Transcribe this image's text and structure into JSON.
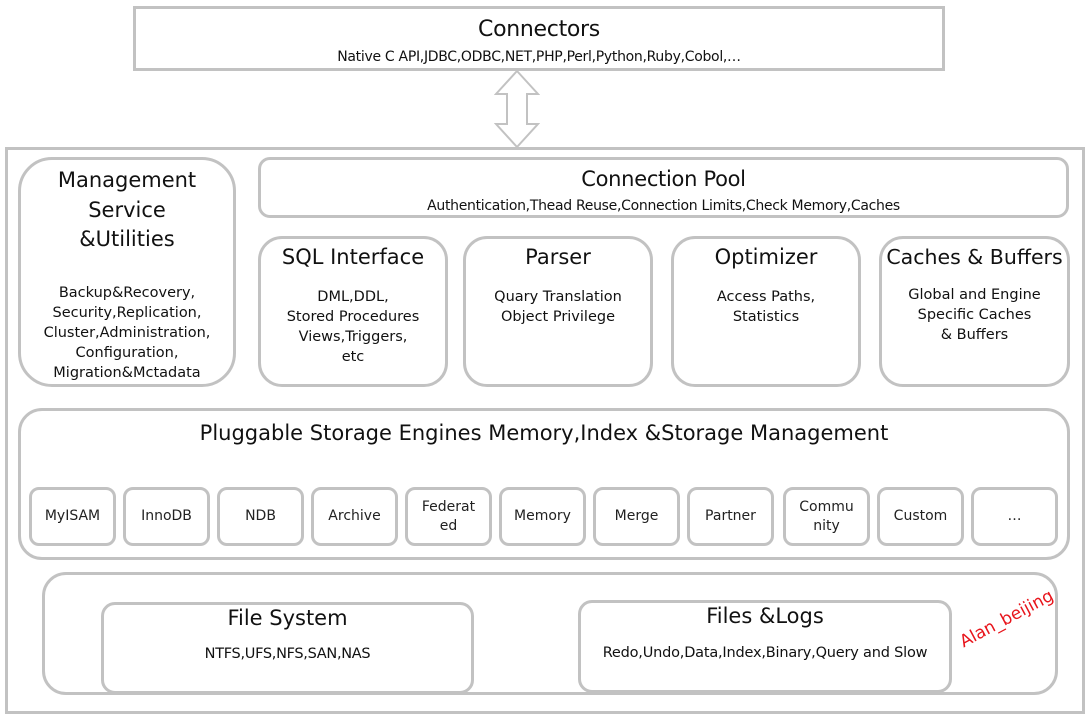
{
  "connectors": {
    "title": "Connectors",
    "items": "Native C API,JDBC,ODBC,NET,PHP,Perl,Python,Ruby,Cobol,…"
  },
  "arrow": {
    "icon": "double-headed-vertical-arrow"
  },
  "management": {
    "title": "Management\nService\n&Utilities",
    "items": "Backup&Recovery,\nSecurity,Replication,\nCluster,Administration,\nConfiguration,\nMigration&Mctadata"
  },
  "connection_pool": {
    "title": "Connection Pool",
    "items": "Authentication,Thead Reuse,Connection Limits,Check Memory,Caches"
  },
  "sql_interface": {
    "title": "SQL Interface",
    "items": "DML,DDL,\nStored Procedures\nViews,Triggers,\netc"
  },
  "parser": {
    "title": "Parser",
    "items": "Quary Translation\nObject Privilege"
  },
  "optimizer": {
    "title": "Optimizer",
    "items": "Access Paths,\nStatistics"
  },
  "caches_buffers": {
    "title": "Caches & Buffers",
    "items": "Global and Engine\nSpecific Caches\n& Buffers"
  },
  "storage_engines": {
    "title": "Pluggable Storage Engines Memory,Index &Storage Management",
    "engines": [
      "MyISAM",
      "InnoDB",
      "NDB",
      "Archive",
      "Federat\ned",
      "Memory",
      "Merge",
      "Partner",
      "Commu\nnity",
      "Custom",
      "…"
    ]
  },
  "file_system": {
    "title": "File System",
    "items": "NTFS,UFS,NFS,SAN,NAS"
  },
  "files_logs": {
    "title": "Files &Logs",
    "items": "Redo,Undo,Data,Index,Binary,Query and Slow"
  },
  "watermark": "Alan_beijing",
  "colors": {
    "border": "#c2c2c2",
    "watermark": "#e8141b",
    "text": "#111111"
  }
}
